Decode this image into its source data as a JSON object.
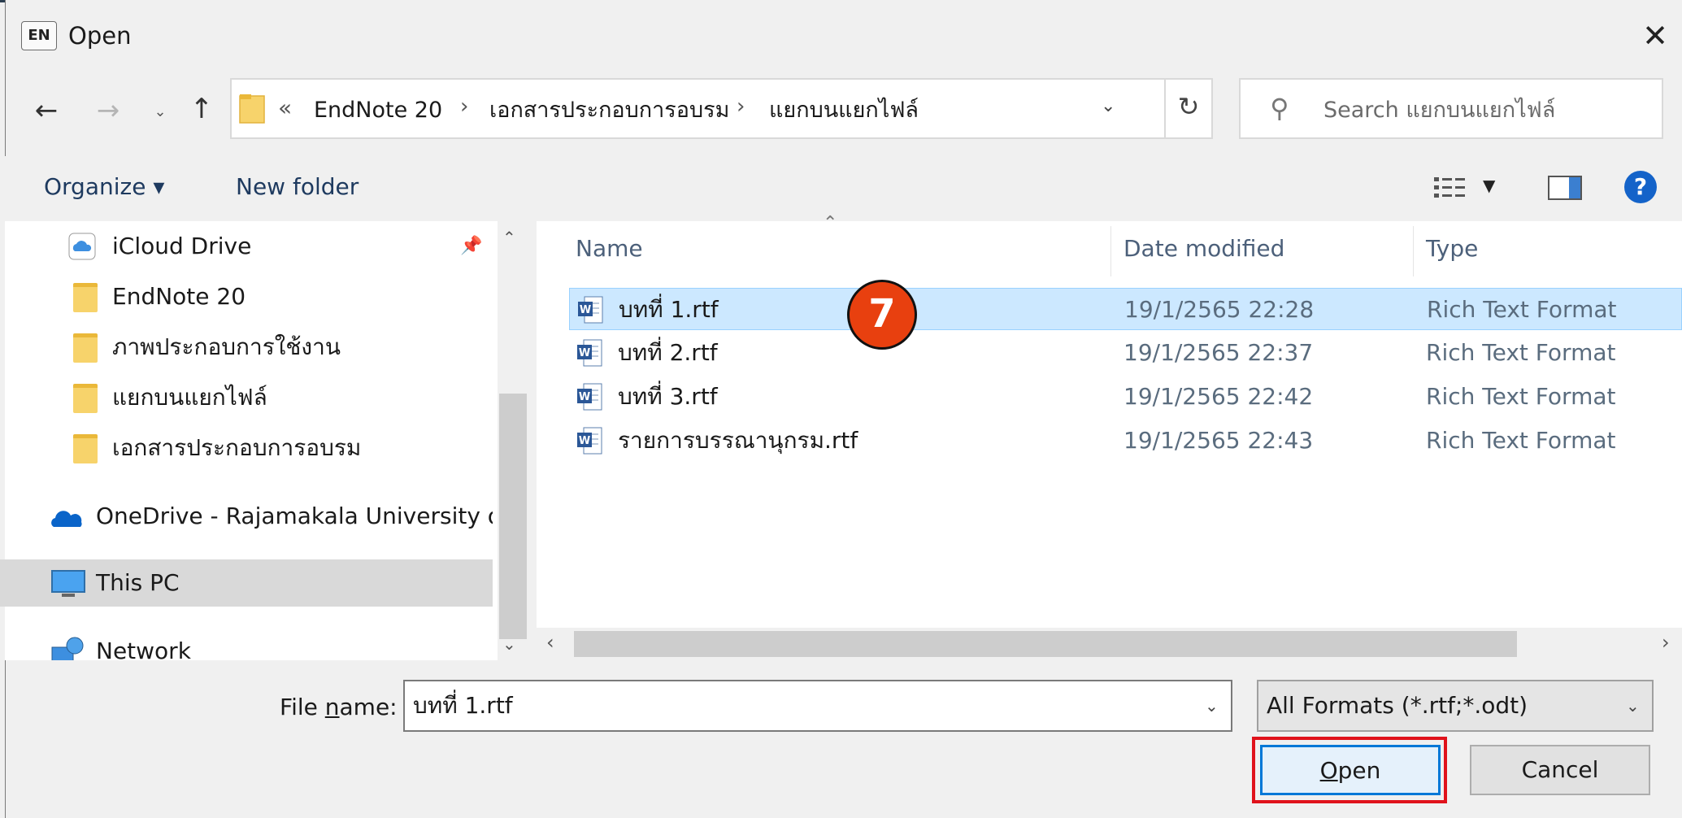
{
  "window": {
    "app_badge": "EN",
    "title": "Open",
    "close_glyph": "✕"
  },
  "nav": {
    "back_icon": "arrow-left-icon",
    "forward_icon": "arrow-right-icon",
    "up_icon": "arrow-up-icon"
  },
  "address": {
    "overflow": "«",
    "crumbs": [
      "EndNote 20",
      "เอกสารประกอบการอบรม",
      "แยกบนแยกไฟล์"
    ],
    "separator": "›"
  },
  "search": {
    "placeholder": "Search แยกบนแยกไฟล์"
  },
  "toolbar": {
    "organize_label": "Organize ▾",
    "new_folder_label": "New folder",
    "help_label": "?"
  },
  "sidebar": {
    "items": [
      {
        "label": "iCloud Drive",
        "icon": "icloud-icon"
      },
      {
        "label": "EndNote 20",
        "icon": "folder-icon"
      },
      {
        "label": "ภาพประกอบการใช้งาน",
        "icon": "folder-icon"
      },
      {
        "label": "แยกบนแยกไฟล์",
        "icon": "folder-icon"
      },
      {
        "label": "เอกสารประกอบการอบรม",
        "icon": "folder-icon"
      },
      {
        "label": "OneDrive - Rajamakala University of",
        "icon": "onedrive-icon"
      },
      {
        "label": "This PC",
        "icon": "computer-icon"
      },
      {
        "label": "Network",
        "icon": "network-icon"
      }
    ]
  },
  "files": {
    "columns": [
      "Name",
      "Date modified",
      "Type"
    ],
    "rows": [
      {
        "name": "บทที่ 1.rtf",
        "date": "19/1/2565 22:28",
        "type": "Rich Text Format"
      },
      {
        "name": "บทที่ 2.rtf",
        "date": "19/1/2565 22:37",
        "type": "Rich Text Format"
      },
      {
        "name": "บทที่ 3.rtf",
        "date": "19/1/2565 22:42",
        "type": "Rich Text Format"
      },
      {
        "name": "รายการบรรณานุกรม.rtf",
        "date": "19/1/2565 22:43",
        "type": "Rich Text Format"
      }
    ]
  },
  "step_badge": "7",
  "footer": {
    "file_name_label_pre": "File ",
    "file_name_label_ul": "n",
    "file_name_label_post": "ame:",
    "file_name_value": "บทที่ 1.rtf",
    "filter_value": "All Formats (*.rtf;*.odt)",
    "open_ul": "O",
    "open_rest": "pen",
    "cancel_label": "Cancel"
  },
  "colors": {
    "accent": "#0078d7",
    "selection": "#cce8ff",
    "highlight_box": "#e0121b",
    "step_badge": "#e8400f"
  }
}
